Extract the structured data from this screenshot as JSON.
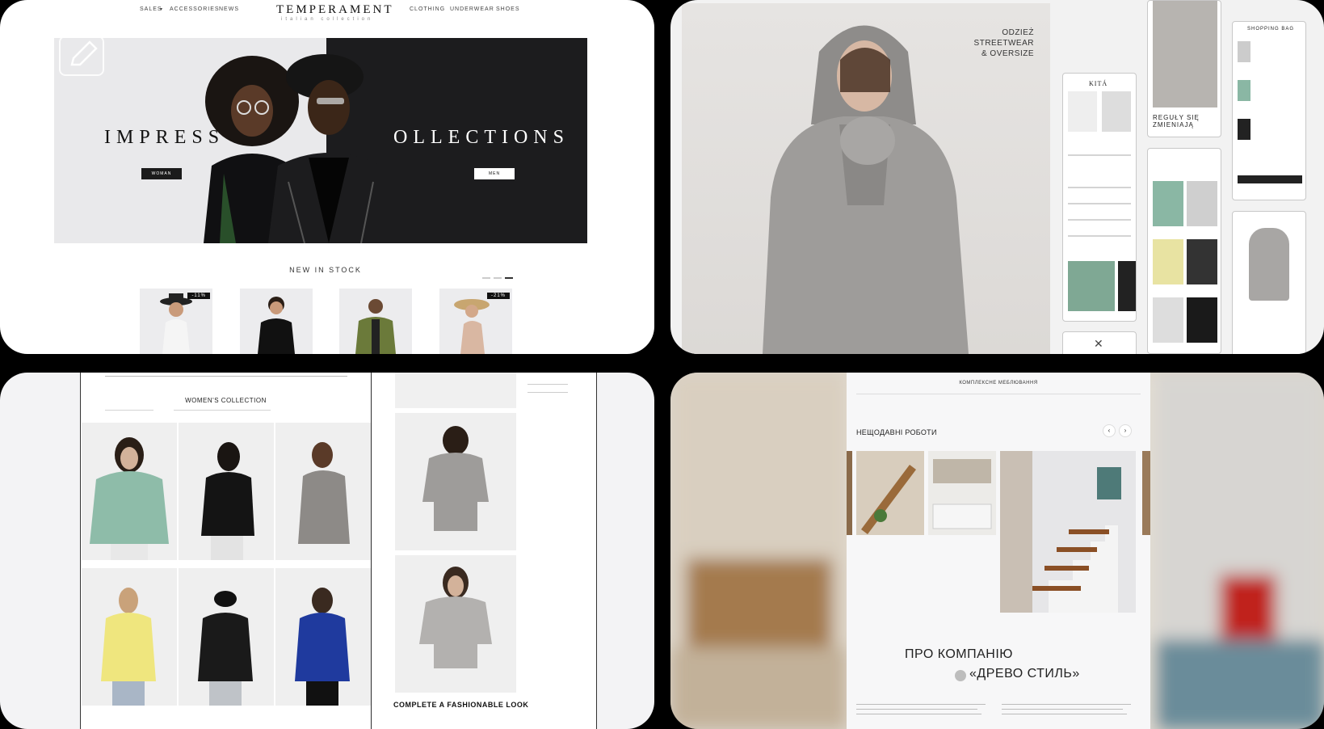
{
  "tile1": {
    "nav_left": [
      "SALES",
      "ACCESSORIES",
      "NEWS"
    ],
    "logo": "TEMPERAMENT",
    "logo_sub": "italian collection",
    "nav_right": [
      "CLOTHING",
      "UNDERWEAR",
      "SHOES"
    ],
    "hero_left_word": "IMPRESS",
    "hero_right_word": "OLLECTIONS",
    "women_btn": "WOMAN",
    "men_btn": "MEN",
    "section_title": "NEW IN STOCK",
    "badges": [
      "-11%",
      "-21%"
    ]
  },
  "tile2": {
    "caption_lines": [
      "ODZIEŻ",
      "STREETWEAR",
      "& OVERSIZE"
    ],
    "brand": "KITÁ",
    "slogan_lines": [
      "REGUŁY SIĘ",
      "ZMIENIAJĄ"
    ],
    "bag_title": "SHOPPING BAG"
  },
  "tile3": {
    "page_title": "WOMEN'S COLLECTION",
    "complete_look": "COMPLETE A FASHIONABLE LOOK"
  },
  "tile4": {
    "top_label": "КОМПЛЕКСНЕ МЕБЛЮВАННЯ",
    "recent_title": "НЕЩОДАВНІ РОБОТИ",
    "prev_arrow": "‹",
    "next_arrow": "›",
    "about_title": "ПРО КОМПАНІЮ",
    "company_name": "«ДРЕВО СТИЛЬ»"
  }
}
